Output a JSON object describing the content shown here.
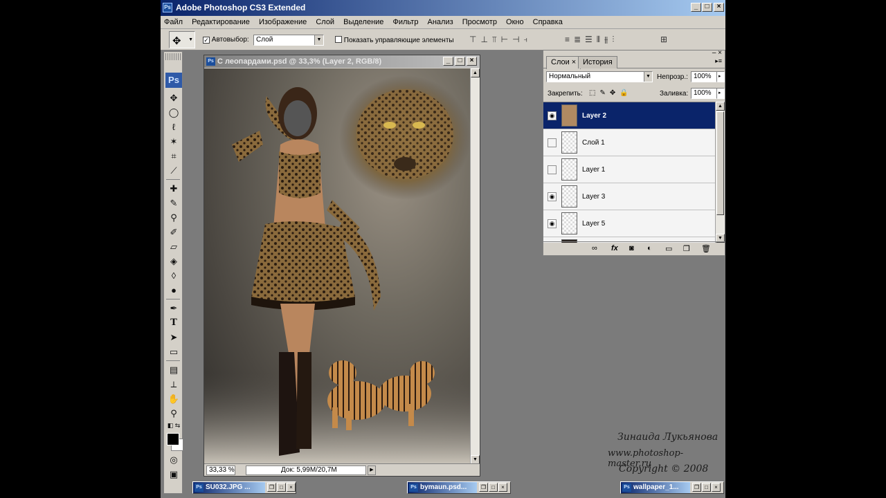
{
  "window": {
    "title": "Adobe Photoshop CS3 Extended",
    "app_icon": "Ps"
  },
  "menu": [
    "Файл",
    "Редактирование",
    "Изображение",
    "Слой",
    "Выделение",
    "Фильтр",
    "Анализ",
    "Просмотр",
    "Окно",
    "Справка"
  ],
  "options": {
    "autoselect_label": "Автовыбор:",
    "autoselect_checked": true,
    "autoselect_value": "Слой",
    "show_controls_label": "Показать управляющие элементы",
    "show_controls_checked": false
  },
  "toolbox": {
    "logo": "Ps"
  },
  "document": {
    "title": "С леопардами.psd @ 33,3% (Layer 2, RGB/8)",
    "zoom": "33,33 %",
    "doc_size": "Док: 5,99M/20,7M"
  },
  "layers_panel": {
    "tab_layers": "Слои",
    "tab_history": "История",
    "blend_mode": "Нормальный",
    "opacity_label": "Непрозр.:",
    "opacity_value": "100%",
    "lock_label": "Закрепить:",
    "fill_label": "Заливка:",
    "fill_value": "100%",
    "layers": [
      {
        "name": "Layer 2",
        "visible": true,
        "selected": true
      },
      {
        "name": "Слой 1",
        "visible": false,
        "selected": false
      },
      {
        "name": "Layer 1",
        "visible": false,
        "selected": false
      },
      {
        "name": "Layer 3",
        "visible": true,
        "selected": false
      },
      {
        "name": "Layer 5",
        "visible": true,
        "selected": false
      }
    ],
    "footer_icons": [
      "link-icon",
      "fx-icon",
      "mask-icon",
      "adjustment-icon",
      "folder-icon",
      "new-layer-icon",
      "trash-icon"
    ],
    "fx_label": "fx"
  },
  "minimized": [
    {
      "title": "SU032.JPG ..."
    },
    {
      "title": "bymaun.psd..."
    },
    {
      "title": "wallpaper_1..."
    }
  ],
  "watermark": {
    "line1": "Зинаида Лукьянова",
    "line2": "www.photoshop-master.ru",
    "line3": "Copyright © 2008"
  }
}
